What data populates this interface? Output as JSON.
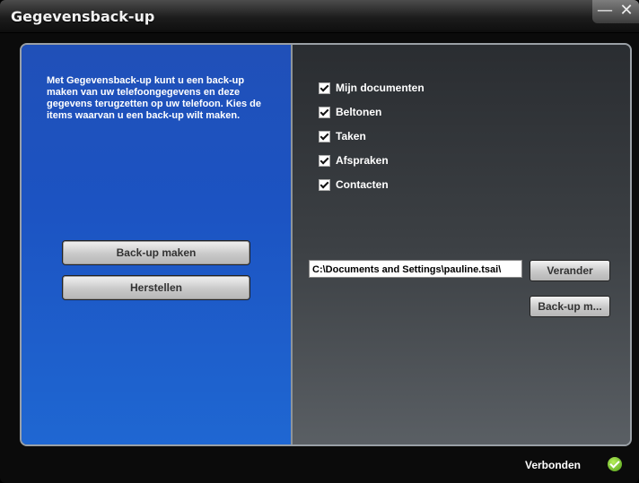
{
  "window": {
    "title": "Gegevensback-up",
    "minimize_label": "—",
    "close_label": "✕"
  },
  "left_panel": {
    "description": "Met Gegevensback-up kunt u een back-up maken van uw telefoongegevens en deze gegevens terugzetten op uw telefoon. Kies de items waarvan u een back-up wilt maken.",
    "backup_button": "Back-up maken",
    "restore_button": "Herstellen"
  },
  "right_panel": {
    "items": [
      {
        "label": "Mijn documenten",
        "checked": true
      },
      {
        "label": "Beltonen",
        "checked": true
      },
      {
        "label": "Taken",
        "checked": true
      },
      {
        "label": "Afspraken",
        "checked": true
      },
      {
        "label": "Contacten",
        "checked": true
      }
    ],
    "path_value": "C:\\Documents and Settings\\pauline.tsai\\",
    "change_button": "Verander",
    "backup_button_short": "Back-up m..."
  },
  "status": {
    "text": "Verbonden",
    "icon": "connected-check-icon",
    "icon_color": "#6fbf2a"
  }
}
